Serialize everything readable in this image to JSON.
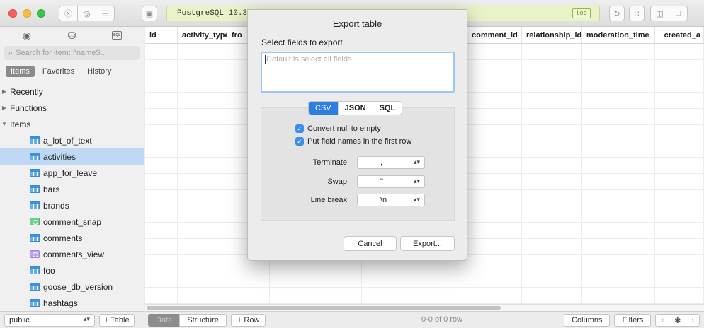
{
  "toolbar": {
    "connection_text": "PostgreSQL 10.3",
    "loc_badge": "loc"
  },
  "sidebar": {
    "search_placeholder": "Search for item: ^name$...",
    "tabs": [
      {
        "label": "Items",
        "active": true
      },
      {
        "label": "Favorites",
        "active": false
      },
      {
        "label": "History",
        "active": false
      }
    ],
    "groups": {
      "recently": "Recently",
      "functions": "Functions",
      "items": "Items"
    },
    "items": [
      {
        "label": "a_lot_of_text",
        "kind": "table",
        "selected": false
      },
      {
        "label": "activities",
        "kind": "table",
        "selected": true
      },
      {
        "label": "app_for_leave",
        "kind": "table",
        "selected": false
      },
      {
        "label": "bars",
        "kind": "table",
        "selected": false
      },
      {
        "label": "brands",
        "kind": "table",
        "selected": false
      },
      {
        "label": "comment_snap",
        "kind": "view-green",
        "selected": false
      },
      {
        "label": "comments",
        "kind": "table",
        "selected": false
      },
      {
        "label": "comments_view",
        "kind": "view-purple",
        "selected": false
      },
      {
        "label": "foo",
        "kind": "table",
        "selected": false
      },
      {
        "label": "goose_db_version",
        "kind": "table",
        "selected": false
      },
      {
        "label": "hashtags",
        "kind": "table",
        "selected": false
      }
    ],
    "schema": "public",
    "add_table_label": "+ Table"
  },
  "grid": {
    "columns": [
      {
        "label": "id"
      },
      {
        "label": "activity_type"
      },
      {
        "label": "fro"
      },
      {
        "label": ""
      },
      {
        "label": ""
      },
      {
        "label": ""
      },
      {
        "label": ""
      },
      {
        "label": "comment_id"
      },
      {
        "label": "relationship_id"
      },
      {
        "label": "moderation_time"
      },
      {
        "label": "created_a"
      }
    ]
  },
  "bottom_bar": {
    "data_tab": "Data",
    "structure_tab": "Structure",
    "add_row": "+ Row",
    "count": "0-0 of 0 row",
    "columns_btn": "Columns",
    "filters_btn": "Filters"
  },
  "export_dialog": {
    "title": "Export table",
    "subtitle": "Select fields to export",
    "fields_placeholder": "Default is select all fields",
    "formats": [
      {
        "label": "CSV",
        "active": true
      },
      {
        "label": "JSON",
        "active": false
      },
      {
        "label": "SQL",
        "active": false
      }
    ],
    "checkboxes": [
      {
        "label": "Convert null to empty",
        "checked": true
      },
      {
        "label": "Put field names in the first row",
        "checked": true
      }
    ],
    "options": [
      {
        "label": "Terminate",
        "value": ","
      },
      {
        "label": "Swap",
        "value": "\""
      },
      {
        "label": "Line break",
        "value": "\\n"
      }
    ],
    "cancel_label": "Cancel",
    "export_label": "Export..."
  },
  "colors": {
    "selection": "#bfd9f5",
    "accent": "#2e7de1",
    "connection_bar": "#e8f3c8"
  }
}
